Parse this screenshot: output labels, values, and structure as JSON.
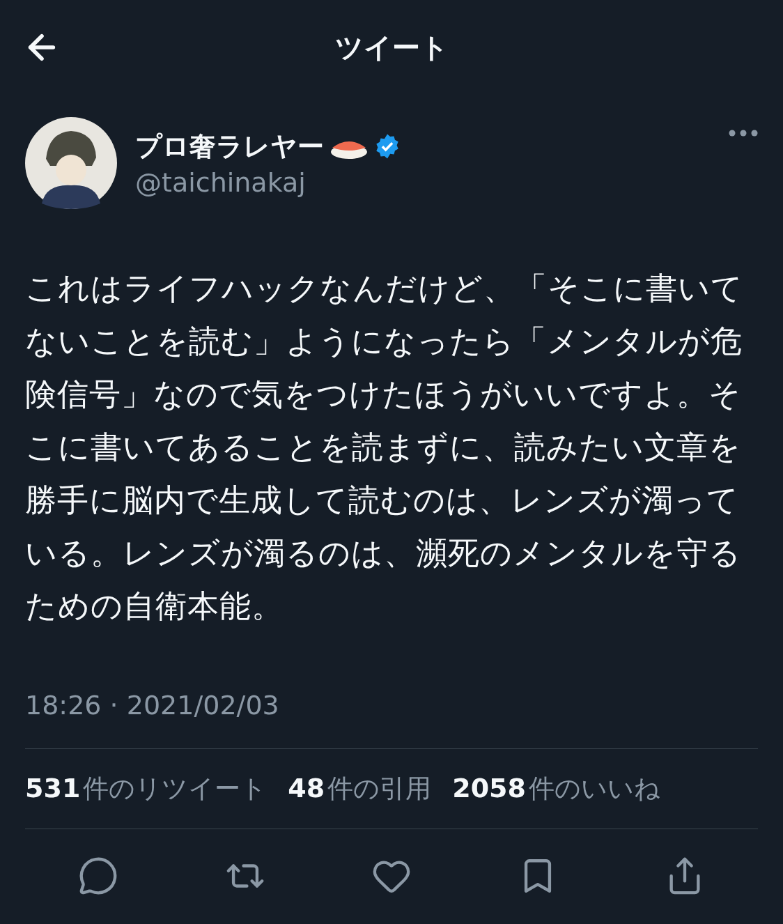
{
  "header": {
    "title": "ツイート"
  },
  "author": {
    "name": "プロ奢ラレヤー",
    "handle": "@taichinakaj",
    "verified": true
  },
  "tweet": {
    "text": "これはライフハックなんだけど、「そこに書いてないことを読む」ようになったら「メンタルが危険信号」なので気をつけたほうがいいですよ。そこに書いてあることを読まずに、読みたい文章を勝手に脳内で生成して読むのは、レンズが濁っている。レンズが濁るのは、瀕死のメンタルを守るための自衛本能。",
    "timestamp": "18:26 · 2021/02/03"
  },
  "stats": [
    {
      "count": "531",
      "label": "件のリツイート"
    },
    {
      "count": "48",
      "label": "件の引用"
    },
    {
      "count": "2058",
      "label": "件のいいね"
    }
  ],
  "actions": [
    {
      "kind": "reply"
    },
    {
      "kind": "retweet"
    },
    {
      "kind": "like"
    },
    {
      "kind": "bookmark"
    },
    {
      "kind": "share"
    }
  ]
}
